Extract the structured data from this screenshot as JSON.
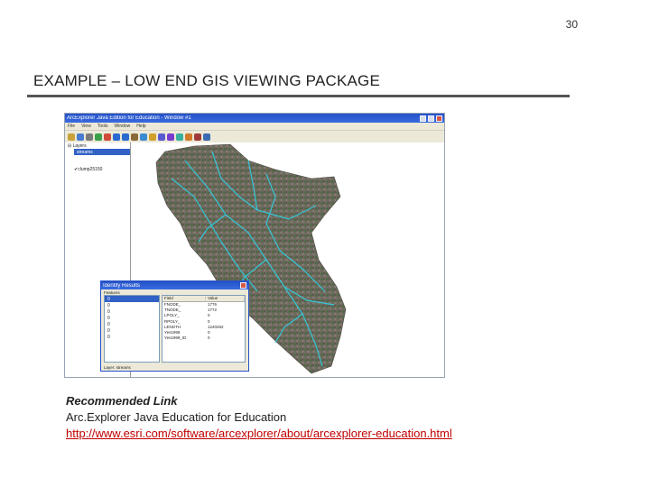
{
  "slide": {
    "page_number": "30",
    "title": "EXAMPLE – LOW END GIS VIEWING PACKAGE"
  },
  "app": {
    "window_title": "ArcExplorer Java Edition for Education - Window #1",
    "menu": [
      "File",
      "View",
      "Tools",
      "Window",
      "Help"
    ],
    "toolbar_icons": [
      "open-icon",
      "save-icon",
      "print-icon",
      "add-layer-icon",
      "remove-layer-icon",
      "zoom-in-icon",
      "zoom-out-icon",
      "pan-icon",
      "full-extent-icon",
      "identify-icon",
      "find-icon",
      "measure-icon",
      "select-icon",
      "query-icon",
      "clear-icon",
      "help-icon"
    ],
    "toolbar_colors": [
      "#c9a23a",
      "#4a7bd0",
      "#7a7a7a",
      "#3aa04a",
      "#d04a3a",
      "#2a6ad0",
      "#2a6ad0",
      "#8a6a3a",
      "#3a8ad0",
      "#d0a02a",
      "#5a5ad0",
      "#7a3ad0",
      "#3ab0a0",
      "#d07a2a",
      "#a03a3a",
      "#3a6ab0"
    ],
    "legend": {
      "header": "Layers",
      "items": [
        "streams",
        "clump25150"
      ]
    },
    "map": {
      "terrain_color": "#6f6a60",
      "vegetation_color": "#3f6a3a",
      "stream_color": "#34c6d8"
    }
  },
  "identify": {
    "window_title": "Identify Results",
    "sub_label": "Features",
    "left_rows": [
      "0",
      "0",
      "0",
      "0",
      "0",
      "0",
      "0"
    ],
    "headers": [
      "Field",
      "Value"
    ],
    "rows": [
      {
        "field": "FNODE_",
        "value": "1776"
      },
      {
        "field": "TNODE_",
        "value": "1772"
      },
      {
        "field": "LPOLY_",
        "value": "0"
      },
      {
        "field": "RPOLY_",
        "value": "0"
      },
      {
        "field": "LENGTH",
        "value": "1240262"
      },
      {
        "field": "Yes1999",
        "value": "0"
      },
      {
        "field": "Yes1999_ID",
        "value": "0"
      }
    ],
    "status": "Layer: streams"
  },
  "caption": {
    "heading": "Recommended Link",
    "description": "Arc.Explorer Java Education for Education",
    "link": "http://www.esri.com/software/arcexplorer/about/arcexplorer-education.html"
  }
}
